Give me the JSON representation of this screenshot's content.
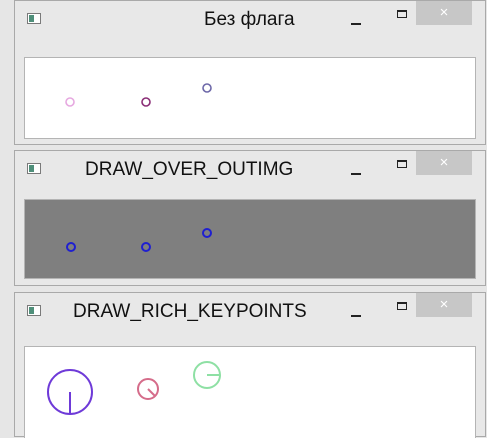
{
  "windows": [
    {
      "title": "Без флага",
      "close_label": "×",
      "canvas_background": "#ffffff",
      "keypoints": [
        {
          "color": "#e6a8e0",
          "style": "plain"
        },
        {
          "color": "#8a2d76",
          "style": "plain"
        },
        {
          "color": "#6c67a8",
          "style": "plain"
        }
      ]
    },
    {
      "title": "DRAW_OVER_OUTIMG",
      "close_label": "×",
      "canvas_background": "#7f7f7f",
      "keypoints": [
        {
          "color": "#1f1fd0",
          "style": "plain"
        },
        {
          "color": "#1f1fd0",
          "style": "plain"
        },
        {
          "color": "#1f1fd0",
          "style": "plain"
        }
      ]
    },
    {
      "title": "DRAW_RICH_KEYPOINTS",
      "close_label": "×",
      "canvas_background": "#ffffff",
      "keypoints": [
        {
          "color": "#6e3ad8",
          "style": "rich"
        },
        {
          "color": "#d56c8a",
          "style": "rich"
        },
        {
          "color": "#8ee0a4",
          "style": "rich"
        }
      ]
    }
  ]
}
